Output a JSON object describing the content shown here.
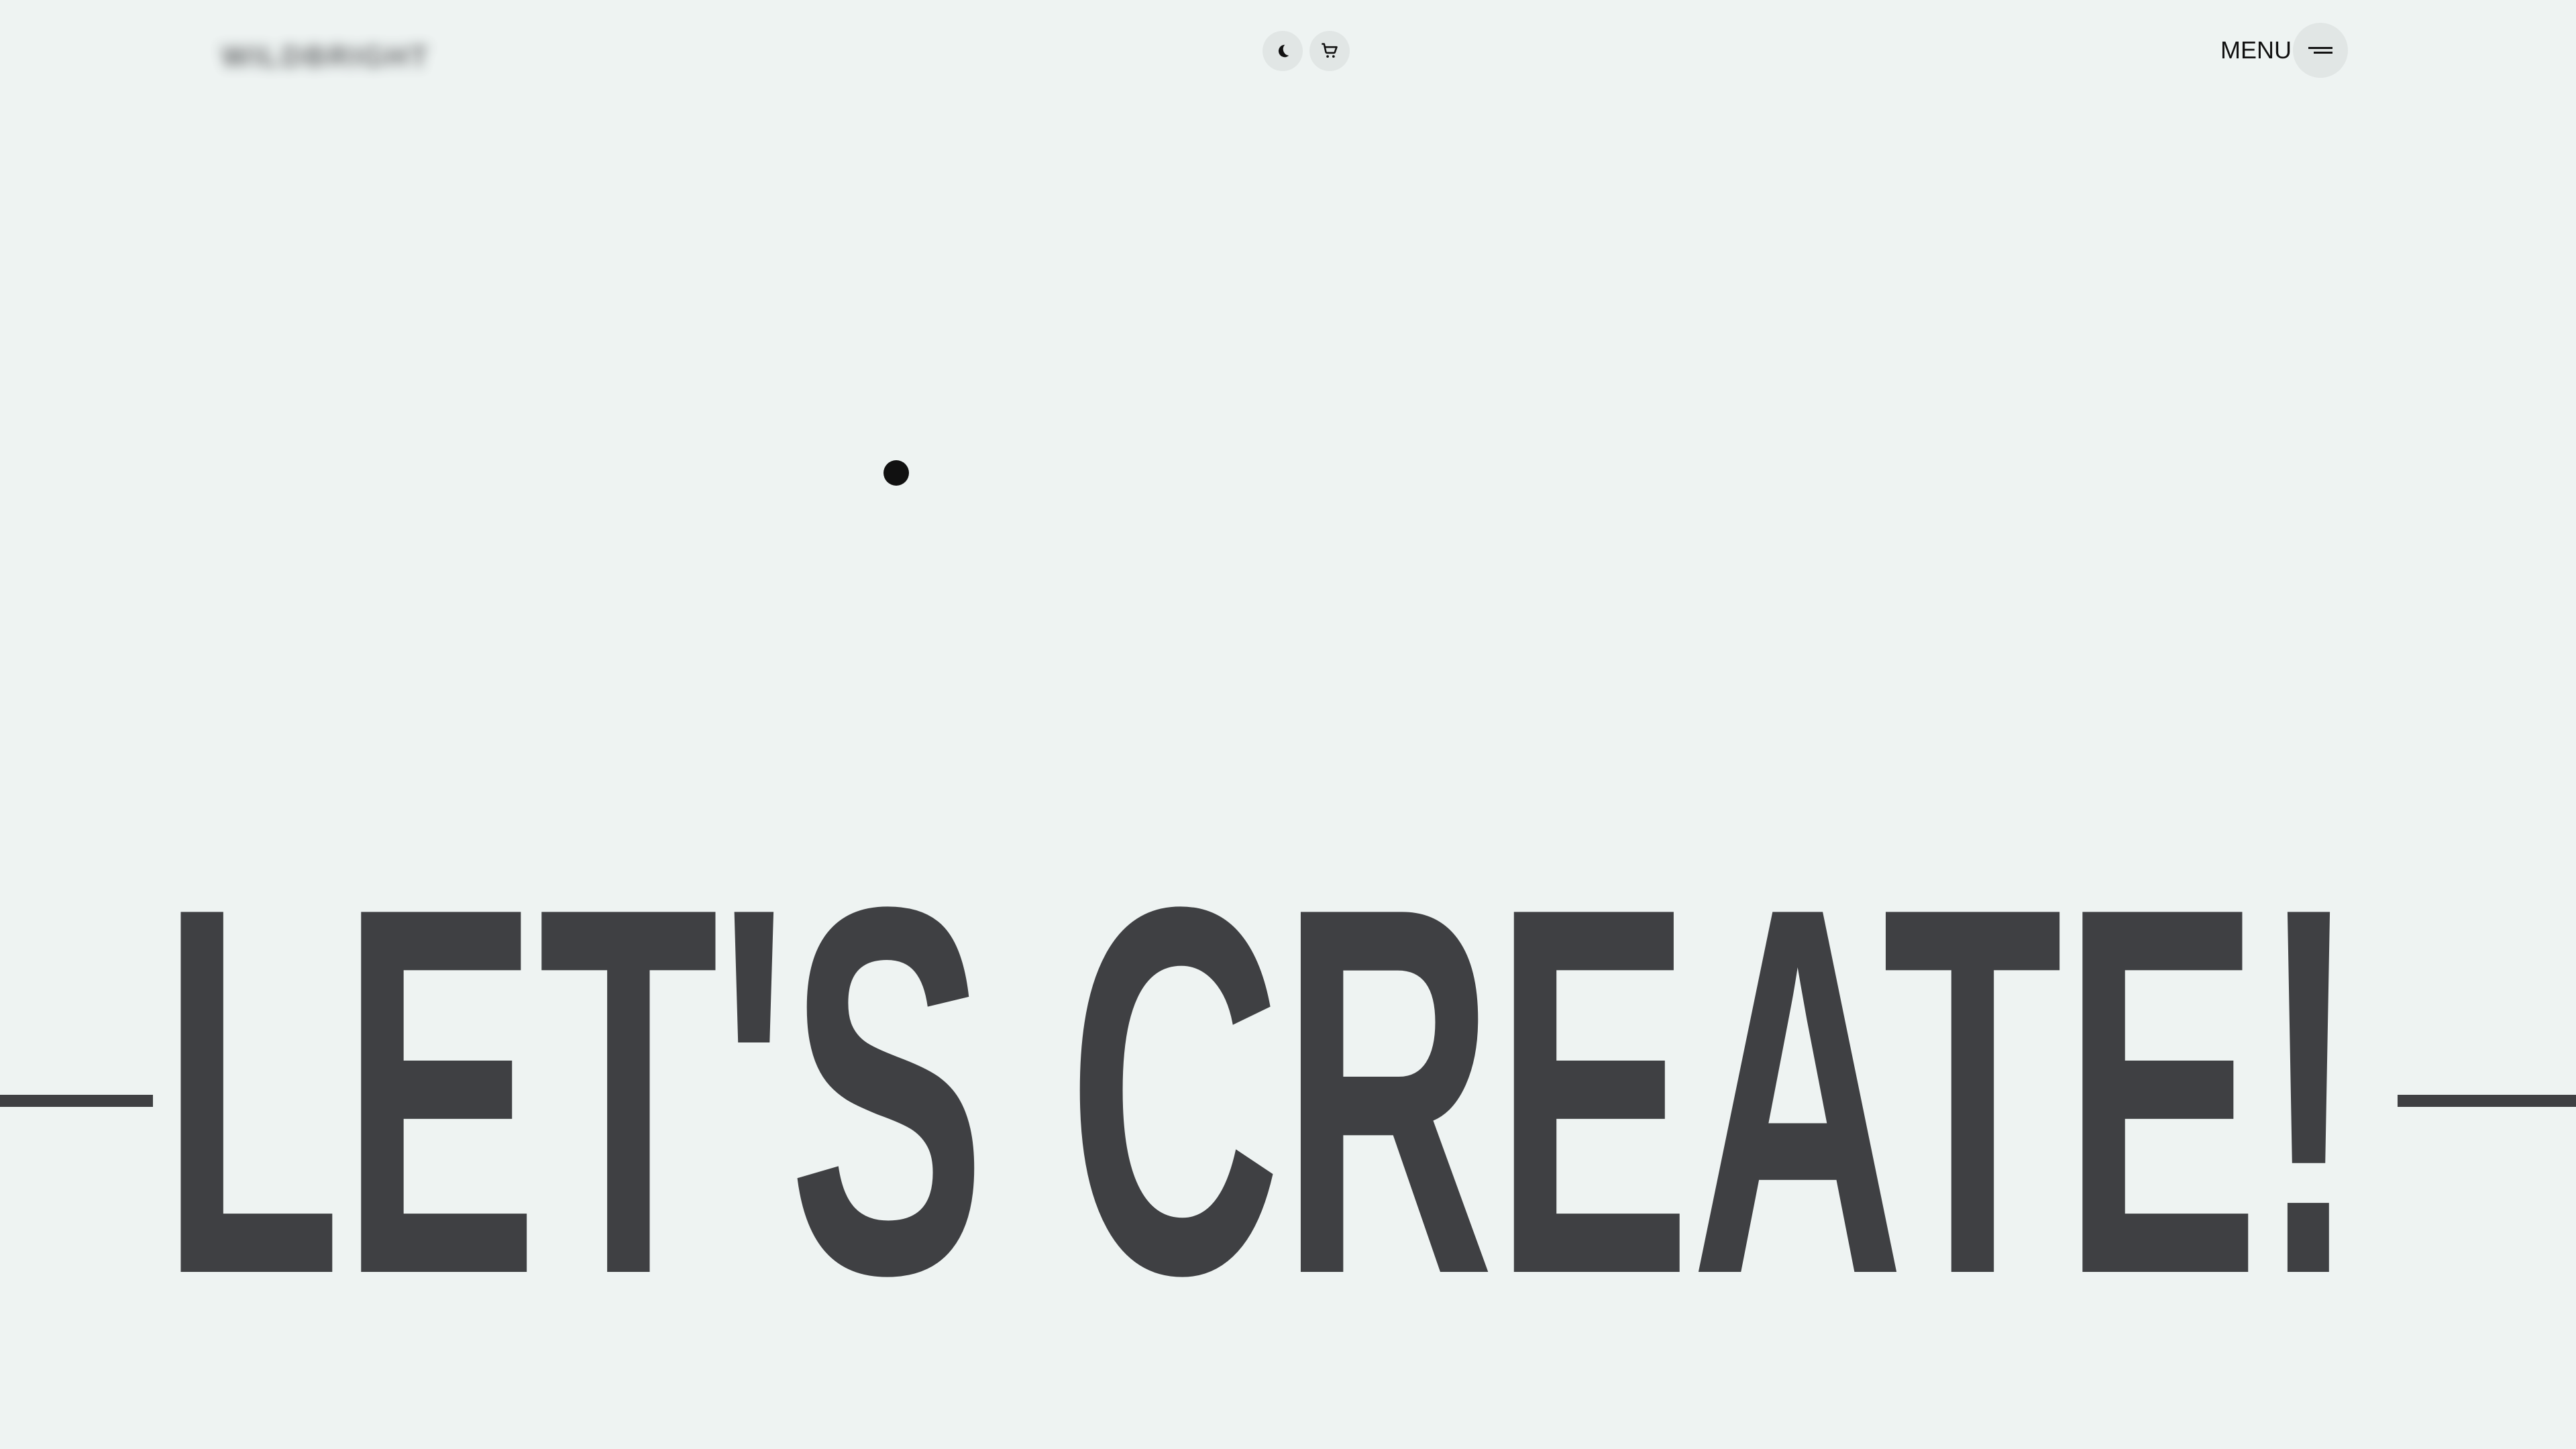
{
  "header": {
    "logo_text": "WILDBRIGHT",
    "theme_icon": "moon-icon",
    "cart_icon": "cart-icon",
    "menu_label": "MENU",
    "menu_icon": "menu-lines-icon"
  },
  "hero": {
    "headline": "LET'S CREATE!"
  },
  "colors": {
    "background": "#eef3f2",
    "headline": "#3f4043",
    "icon_button_bg": "#e1e6e5",
    "text": "#111111"
  }
}
